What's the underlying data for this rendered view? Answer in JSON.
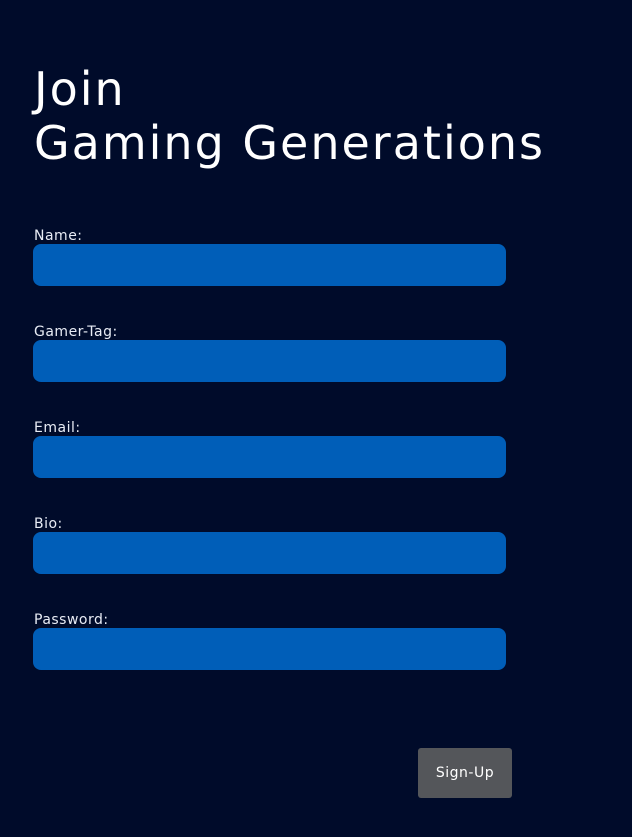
{
  "page": {
    "title_line1": "Join",
    "title_line2": "Gaming Generations"
  },
  "form": {
    "fields": [
      {
        "label": "Name:",
        "value": ""
      },
      {
        "label": "Gamer-Tag:",
        "value": ""
      },
      {
        "label": "Email:",
        "value": ""
      },
      {
        "label": "Bio:",
        "value": ""
      },
      {
        "label": "Password:",
        "value": ""
      }
    ],
    "submit_label": "Sign-Up"
  },
  "colors": {
    "background": "#000b2a",
    "input_fill": "#005eb8",
    "button_fill": "#54565a",
    "text": "#ffffff"
  }
}
